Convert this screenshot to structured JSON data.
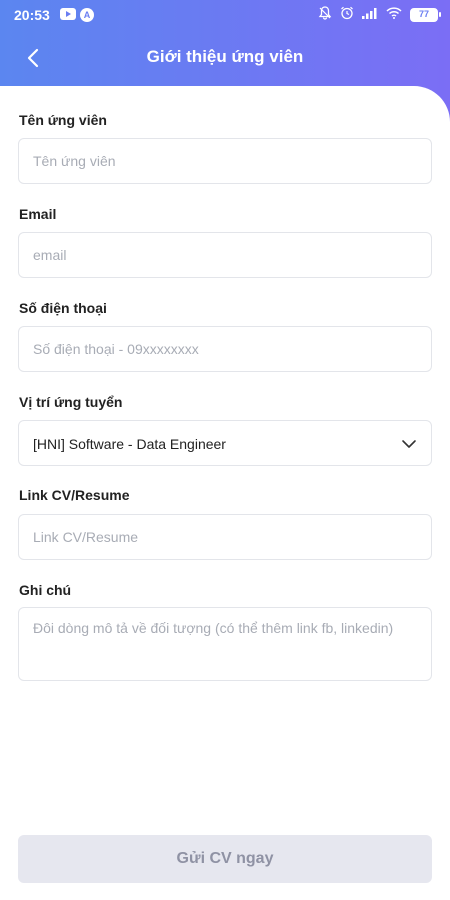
{
  "status_bar": {
    "time": "20:53",
    "battery": "77",
    "left_icons": [
      "youtube-icon",
      "a-badge-icon"
    ],
    "right_icons": [
      "notification-bell-icon",
      "alarm-icon",
      "signal-icon",
      "wifi-icon"
    ]
  },
  "header": {
    "title": "Giới thiệu ứng viên",
    "back_icon": "chevron-left-icon"
  },
  "form": {
    "name": {
      "label": "Tên ứng viên",
      "placeholder": "Tên ứng viên",
      "value": ""
    },
    "email": {
      "label": "Email",
      "placeholder": "email",
      "value": ""
    },
    "phone": {
      "label": "Số điện thoại",
      "placeholder": "Số điện thoại - 09xxxxxxxx",
      "value": ""
    },
    "position": {
      "label": "Vị trí ứng tuyển",
      "value": "[HNI] Software - Data Engineer",
      "icon": "chevron-down-icon"
    },
    "cv_link": {
      "label": "Link CV/Resume",
      "placeholder": "Link CV/Resume",
      "value": ""
    },
    "note": {
      "label": "Ghi chú",
      "placeholder": "Đôi dòng mô tả về đối tượng (có thể thêm link fb, linkedin)",
      "value": ""
    }
  },
  "submit": {
    "label": "Gửi CV ngay"
  },
  "colors": {
    "header_gradient_start": "#5b86f0",
    "header_gradient_end": "#7b6ef5",
    "button_disabled_bg": "#e6e7ef",
    "button_disabled_text": "#8f92a4"
  }
}
